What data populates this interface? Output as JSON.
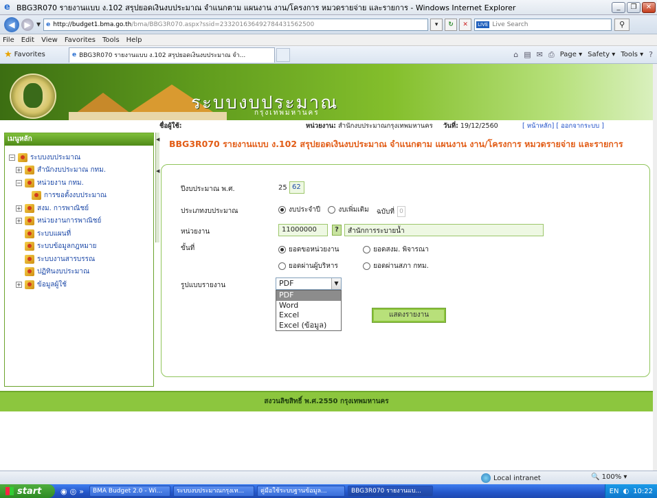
{
  "window": {
    "title": "BBG3R070 รายงานแบบ ง.102 สรุปยอดเงินงบประมาณ จำแนกตาม แผนงาน งาน/โครงการ หมวดรายจ่าย และรายการ - Windows Internet Explorer",
    "minimize": "_",
    "restore": "❐",
    "close": "✕"
  },
  "address": {
    "url_host": "http://budget1.bma.go.th",
    "url_path": "/bma/BBG3R070.aspx?ssid=233201636492784431562500",
    "search_placeholder": "Live Search",
    "search_logo": "LIVE"
  },
  "menu": [
    "File",
    "Edit",
    "View",
    "Favorites",
    "Tools",
    "Help"
  ],
  "favorites": {
    "label": "Favorites",
    "tab_title": "BBG3R070 รายงานแบบ ง.102 สรุปยอดเงินงบประมาณ จำ..."
  },
  "commandbar": {
    "page": "Page ▾",
    "safety": "Safety ▾",
    "tools": "Tools ▾"
  },
  "banner": {
    "title": "ระบบงบประมาณ",
    "subtitle": "กรุงเทพมหานคร"
  },
  "info": {
    "user_label": "ชื่อผู้ใช้:",
    "user_value": "",
    "unit_label": "หน่วยงาน:",
    "unit_value": "สำนักงบประมาณกรุงเทพมหานคร",
    "date_label": "วันที่:",
    "date_value": "19/12/2560",
    "links": "[ หน้าหลัก] [ ออกจากระบบ ]"
  },
  "sidebar": {
    "header": "เมนูหลัก",
    "items": [
      {
        "label": "ระบบงบประมาณ",
        "pm": "−",
        "indent": 0
      },
      {
        "label": "สำนักงบประมาณ กทม.",
        "pm": "+",
        "indent": 1
      },
      {
        "label": "หน่วยงาน กทม.",
        "pm": "−",
        "indent": 1
      },
      {
        "label": "การขอตั้งงบประมาณ",
        "pm": "",
        "indent": 2
      },
      {
        "label": "สงม. การพาณิชย์",
        "pm": "+",
        "indent": 1
      },
      {
        "label": "หน่วยงานการพาณิชย์",
        "pm": "+",
        "indent": 1
      },
      {
        "label": "ระบบแผนที่",
        "pm": "",
        "indent": 1
      },
      {
        "label": "ระบบข้อมูลกฎหมาย",
        "pm": "",
        "indent": 1
      },
      {
        "label": "ระบบงานสารบรรณ",
        "pm": "",
        "indent": 1
      },
      {
        "label": "ปฏิทินงบประมาณ",
        "pm": "",
        "indent": 1
      },
      {
        "label": "ข้อมูลผู้ใช้",
        "pm": "+",
        "indent": 1
      }
    ]
  },
  "report": {
    "heading": "BBG3R070 รายงานแบบ ง.102 สรุปยอดเงินงบประมาณ จำแนกตาม แผนงาน งาน/โครงการ หมวดรายจ่าย และรายการ",
    "fiscal_year_label": "ปีงบประมาณ พ.ศ.",
    "fiscal_year_prefix": "25",
    "fiscal_year_value": "62",
    "budget_type_label": "ประเภทงบประมาณ",
    "budget_type_options": [
      "งบประจำปี",
      "งบเพิ่มเติม"
    ],
    "budget_type_selected": "งบประจำปี",
    "edition_label": "ฉบับที่",
    "edition_value": "0",
    "unit_label": "หน่วยงาน",
    "unit_code": "11000000",
    "unit_lookup": "?",
    "unit_name": "สำนักการระบายน้ำ",
    "stage_label": "ขั้นที่",
    "stage_options": [
      "ยอดขอหน่วยงาน",
      "ยอดสงม. พิจารณา",
      "ยอดผ่านผู้บริหาร",
      "ยอดผ่านสภา กทม."
    ],
    "stage_selected": "ยอดขอหน่วยงาน",
    "format_label": "รูปแบบรายงาน",
    "format_value": "PDF",
    "format_options": [
      "PDF",
      "Word",
      "Excel",
      "Excel (ข้อมูล)"
    ],
    "show_button": "แสดงรายงาน"
  },
  "footer": "สงวนลิขสิทธิ์ พ.ศ.2550 กรุงเทพมหานคร",
  "status": {
    "zone": "Local intranet",
    "zoom": "🔍 100%  ▾"
  },
  "taskbar": {
    "start": "start",
    "tasks": [
      "BMA Budget 2.0 - Wi...",
      "ระบบงบประมาณกรุงเท...",
      "คู่มือใช้ระบบฐานข้อมูล...",
      "BBG3R070 รายงานแบ..."
    ],
    "active_index": 3,
    "lang": "EN",
    "time": "10:22"
  }
}
